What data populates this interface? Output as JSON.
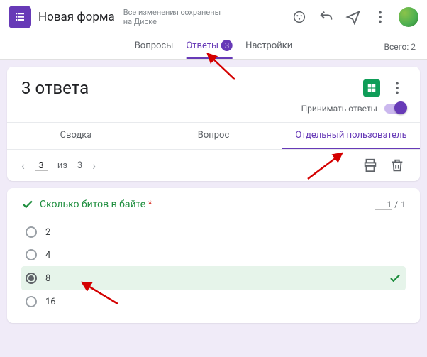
{
  "header": {
    "title": "Новая форма",
    "save_line1": "Все изменения сохранены",
    "save_line2": "на Диске"
  },
  "tabs": {
    "questions": "Вопросы",
    "responses": "Ответы",
    "responses_badge": "3",
    "settings": "Настройки",
    "total_label": "Всего: 2"
  },
  "card": {
    "title": "3 ответа",
    "accept_label": "Принимать ответы"
  },
  "subtabs": {
    "summary": "Сводка",
    "question": "Вопрос",
    "individual": "Отдельный пользователь"
  },
  "pager": {
    "current": "3",
    "of": "из",
    "total": "3"
  },
  "question": {
    "text": "Сколько битов в байте",
    "score_got": "1",
    "score_sep": "/",
    "score_max": "1",
    "options": [
      "2",
      "4",
      "8",
      "16"
    ],
    "selected_index": 2
  }
}
